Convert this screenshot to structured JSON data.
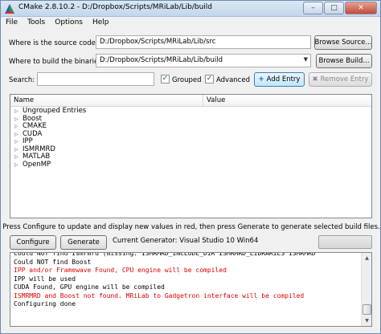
{
  "window": {
    "title": "CMake 2.8.10.2 - D:/Dropbox/Scripts/MRiLab/Lib/build"
  },
  "menu": [
    "File",
    "Tools",
    "Options",
    "Help"
  ],
  "source": {
    "label": "Where is the source code:",
    "value": "D:/Dropbox/Scripts/MRiLab/Lib/src",
    "browse_label": "Browse Source..."
  },
  "build": {
    "label": "Where to build the binaries:",
    "value": "D:/Dropbox/Scripts/MRiLab/Lib/build",
    "browse_label": "Browse Build..."
  },
  "search": {
    "label": "Search:",
    "value": "",
    "grouped_label": "Grouped",
    "grouped_checked": true,
    "advanced_label": "Advanced",
    "advanced_checked": true,
    "add_entry_label": "Add Entry",
    "remove_entry_label": "Remove Entry"
  },
  "tree": {
    "columns": [
      "Name",
      "Value"
    ],
    "rows": [
      "Ungrouped Entries",
      "Boost",
      "CMAKE",
      "CUDA",
      "IPP",
      "ISMRMRD",
      "MATLAB",
      "OpenMP"
    ]
  },
  "status": "Press Configure to update and display new values in red, then press Generate to generate selected build files.",
  "actions": {
    "configure_label": "Configure",
    "generate_label": "Generate",
    "current_generator": "Current Generator: Visual Studio 10 Win64"
  },
  "output": [
    {
      "text": "Could NOT find Ismrmrd (missing:  ISMRMRD_INCLUDE_DIR ISMRMRD_LIBRARIES ISMRMRD",
      "color": "#000000"
    },
    {
      "text": "Could NOT find Boost",
      "color": "#000000"
    },
    {
      "text": "IPP and/or Framewave Found, CPU engine will be compiled",
      "color": "#e00000"
    },
    {
      "text": "IPP will be used",
      "color": "#000000"
    },
    {
      "text": "CUDA Found, GPU engine will be compiled",
      "color": "#000000"
    },
    {
      "text": "ISMRMRD and Boost not found. MRiLab to Gadgetron interface will be compiled",
      "color": "#e00000"
    },
    {
      "text": "Configuring done",
      "color": "#000000"
    }
  ]
}
